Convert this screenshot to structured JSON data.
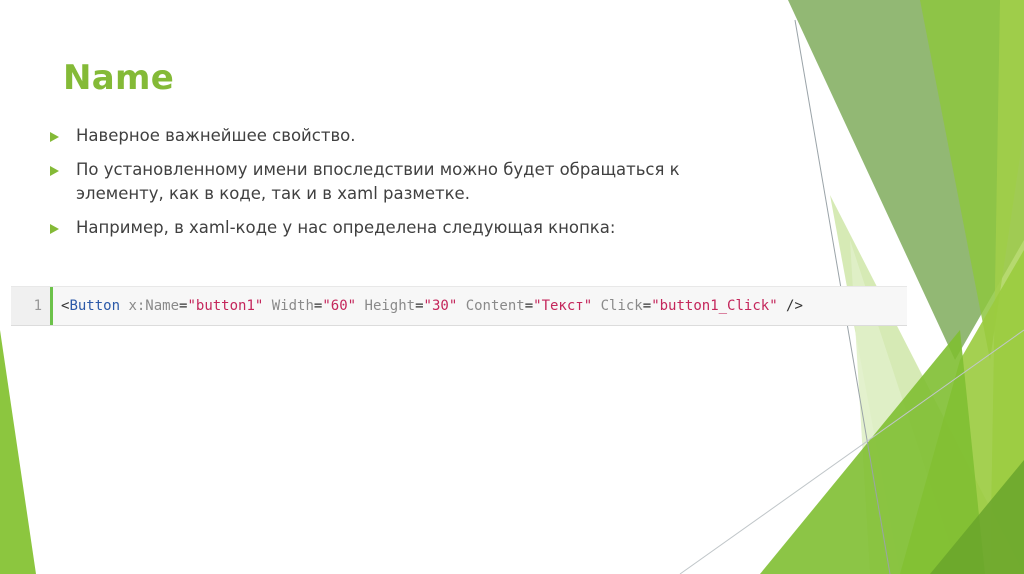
{
  "slide": {
    "title": "Name",
    "bullets": [
      "Наверное важнейшее свойство.",
      "По установленному имени впоследствии можно будет обращаться к элементу, как в коде, так и в xaml разметке.",
      "Например, в xaml-коде у нас определена следующая кнопка:"
    ]
  },
  "code": {
    "line_number": "1",
    "tokens": [
      {
        "text": "<",
        "kind": "punct"
      },
      {
        "text": "Button",
        "kind": "tag"
      },
      {
        "text": " ",
        "kind": "space"
      },
      {
        "text": "x:Name",
        "kind": "attr"
      },
      {
        "text": "=",
        "kind": "punct"
      },
      {
        "text": "\"button1\"",
        "kind": "string"
      },
      {
        "text": " ",
        "kind": "space"
      },
      {
        "text": "Width",
        "kind": "attr"
      },
      {
        "text": "=",
        "kind": "punct"
      },
      {
        "text": "\"60\"",
        "kind": "string"
      },
      {
        "text": " ",
        "kind": "space"
      },
      {
        "text": "Height",
        "kind": "attr"
      },
      {
        "text": "=",
        "kind": "punct"
      },
      {
        "text": "\"30\"",
        "kind": "string"
      },
      {
        "text": " ",
        "kind": "space"
      },
      {
        "text": "Content",
        "kind": "attr"
      },
      {
        "text": "=",
        "kind": "punct"
      },
      {
        "text": "\"Текст\"",
        "kind": "string"
      },
      {
        "text": " ",
        "kind": "space"
      },
      {
        "text": "Click",
        "kind": "attr"
      },
      {
        "text": "=",
        "kind": "punct"
      },
      {
        "text": "\"button1_Click\"",
        "kind": "string"
      },
      {
        "text": " />",
        "kind": "punct"
      }
    ]
  },
  "colors": {
    "title": "#84ba37",
    "body_text": "#404040",
    "bullet": "#84ba37",
    "code_tag": "#2b59a8",
    "code_attr": "#8a8a8a",
    "code_string": "#c4265b",
    "code_punct": "#333333",
    "gutter_accent": "#6cc24a"
  }
}
